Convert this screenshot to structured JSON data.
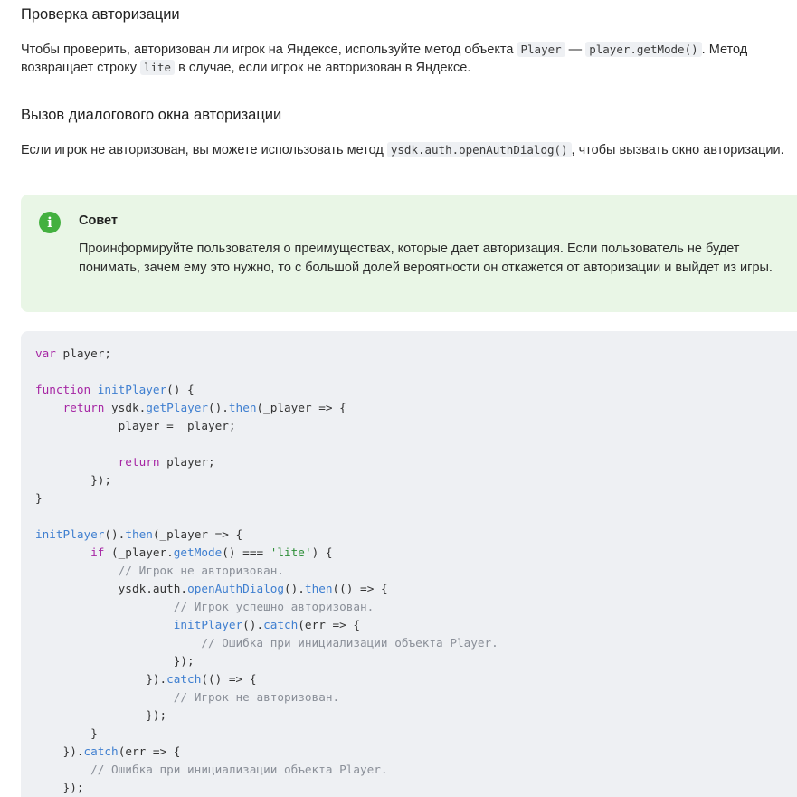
{
  "section1": {
    "title": "Проверка авторизации",
    "para_1": "Чтобы проверить, авторизован ли игрок на Яндексе, используйте метод объекта ",
    "code_player": "Player",
    "para_2": " — ",
    "code_getmode": "player.getMode()",
    "para_3": ". Метод возвращает строку ",
    "code_lite": "lite",
    "para_4": " в случае, если игрок не авторизован в Яндексе."
  },
  "section2": {
    "title": "Вызов диалогового окна авторизации",
    "para_1": "Если игрок не авторизован, вы можете использовать метод ",
    "code_open": "ysdk.auth.openAuthDialog()",
    "para_2": ", чтобы вызвать окно авторизации."
  },
  "tip": {
    "icon": "info-icon",
    "icon_glyph": "i",
    "title": "Совет",
    "text": "Проинформируйте пользователя о преимуществах, которые дает авторизация. Если пользователь не будет понимать, зачем ему это нужно, то с большой долей вероятности он откажется от авторизации и выйдет из игры.",
    "background": "#e9f6e6",
    "icon_color": "#43b03f"
  },
  "code_block": {
    "lines": [
      [
        [
          "kw",
          "var"
        ],
        [
          "plain",
          " player;"
        ]
      ],
      [],
      [
        [
          "kw",
          "function"
        ],
        [
          "plain",
          " "
        ],
        [
          "fn",
          "initPlayer"
        ],
        [
          "plain",
          "() {"
        ]
      ],
      [
        [
          "plain",
          "    "
        ],
        [
          "kw",
          "return"
        ],
        [
          "plain",
          " ysdk."
        ],
        [
          "fn",
          "getPlayer"
        ],
        [
          "plain",
          "()."
        ],
        [
          "fn",
          "then"
        ],
        [
          "plain",
          "(_player => {"
        ]
      ],
      [
        [
          "plain",
          "            player = _player;"
        ]
      ],
      [],
      [
        [
          "plain",
          "            "
        ],
        [
          "kw",
          "return"
        ],
        [
          "plain",
          " player;"
        ]
      ],
      [
        [
          "plain",
          "        });"
        ]
      ],
      [
        [
          "plain",
          "}"
        ]
      ],
      [],
      [
        [
          "fn",
          "initPlayer"
        ],
        [
          "plain",
          "()."
        ],
        [
          "fn",
          "then"
        ],
        [
          "plain",
          "(_player => {"
        ]
      ],
      [
        [
          "plain",
          "        "
        ],
        [
          "kw",
          "if"
        ],
        [
          "plain",
          " (_player."
        ],
        [
          "fn",
          "getMode"
        ],
        [
          "plain",
          "() === "
        ],
        [
          "str",
          "'lite'"
        ],
        [
          "plain",
          ") {"
        ]
      ],
      [
        [
          "plain",
          "            "
        ],
        [
          "com",
          "// Игрок не авторизован."
        ]
      ],
      [
        [
          "plain",
          "            ysdk.auth."
        ],
        [
          "fn",
          "openAuthDialog"
        ],
        [
          "plain",
          "()."
        ],
        [
          "fn",
          "then"
        ],
        [
          "plain",
          "(() => {"
        ]
      ],
      [
        [
          "plain",
          "                    "
        ],
        [
          "com",
          "// Игрок успешно авторизован."
        ]
      ],
      [
        [
          "plain",
          "                    "
        ],
        [
          "fn",
          "initPlayer"
        ],
        [
          "plain",
          "()."
        ],
        [
          "fn",
          "catch"
        ],
        [
          "plain",
          "(err => {"
        ]
      ],
      [
        [
          "plain",
          "                        "
        ],
        [
          "com",
          "// Ошибка при инициализации объекта Player."
        ]
      ],
      [
        [
          "plain",
          "                    });"
        ]
      ],
      [
        [
          "plain",
          "                })."
        ],
        [
          "fn",
          "catch"
        ],
        [
          "plain",
          "(() => {"
        ]
      ],
      [
        [
          "plain",
          "                    "
        ],
        [
          "com",
          "// Игрок не авторизован."
        ]
      ],
      [
        [
          "plain",
          "                });"
        ]
      ],
      [
        [
          "plain",
          "        }"
        ]
      ],
      [
        [
          "plain",
          "    })."
        ],
        [
          "fn",
          "catch"
        ],
        [
          "plain",
          "(err => {"
        ]
      ],
      [
        [
          "plain",
          "        "
        ],
        [
          "com",
          "// Ошибка при инициализации объекта Player."
        ]
      ],
      [
        [
          "plain",
          "    });"
        ]
      ]
    ],
    "colors": {
      "keyword": "#a626a4",
      "function": "#3f7fd0",
      "string": "#2f8f3a",
      "comment": "#8a8f98",
      "plain": "#333333",
      "background": "#eef0f3"
    }
  }
}
